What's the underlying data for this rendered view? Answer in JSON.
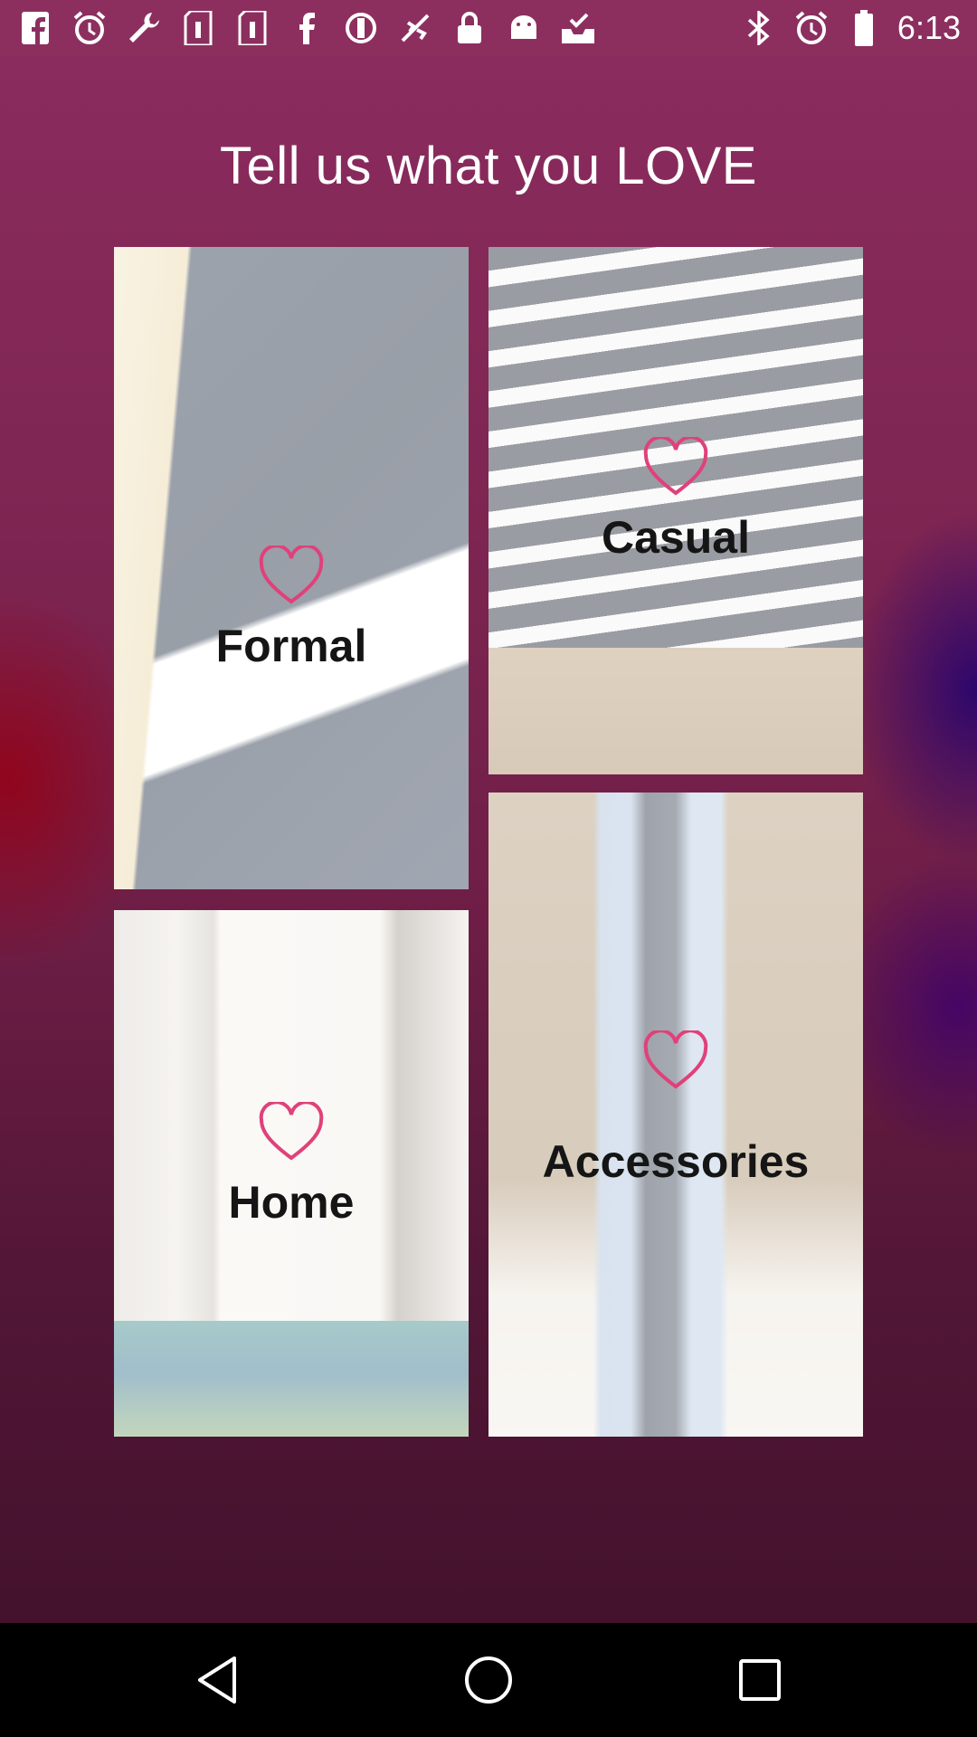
{
  "status_bar": {
    "time": "6:13",
    "left_icons": [
      "facebook-icon",
      "alarm-icon",
      "wrench-icon",
      "sim-icon",
      "sim-icon",
      "facebook-icon",
      "vpn-icon",
      "no-signal-icon",
      "lock-icon",
      "android-icon",
      "inbox-check-icon"
    ],
    "right_icons": [
      "bluetooth-icon",
      "alarm-icon",
      "battery-icon"
    ]
  },
  "title": "Tell us what you LOVE",
  "categories": {
    "formal": {
      "label": "Formal"
    },
    "casual": {
      "label": "Casual"
    },
    "home": {
      "label": "Home"
    },
    "accessories": {
      "label": "Accessories"
    }
  },
  "colors": {
    "heart": "#e0417a",
    "label": "#151515",
    "background_top": "#8a2c5e",
    "background_bottom": "#44122d"
  },
  "nav_bar": {
    "back": "back-icon",
    "home": "home-icon",
    "recents": "recents-icon"
  }
}
